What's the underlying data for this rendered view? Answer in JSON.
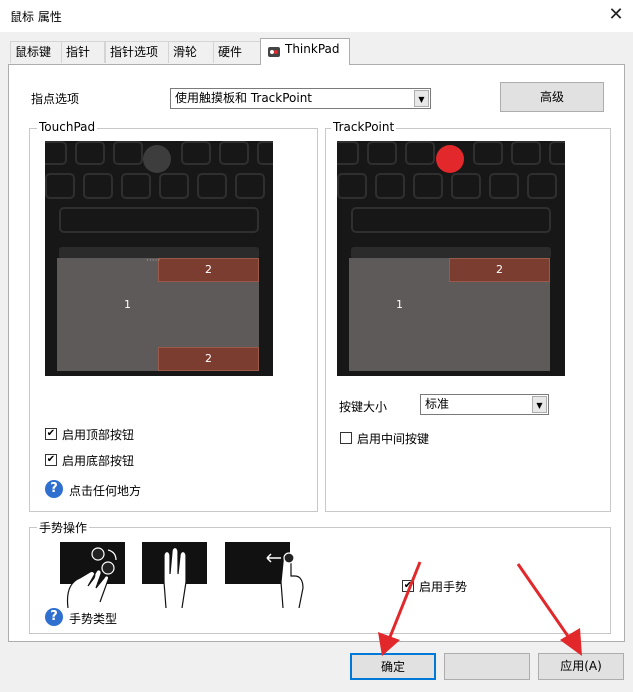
{
  "window": {
    "title": "鼠标 属性",
    "close_label": "✕"
  },
  "tabs": [
    "鼠标键",
    "指针",
    "指针选项",
    "滑轮",
    "硬件",
    "ThinkPad"
  ],
  "pointing": {
    "label": "指点选项",
    "value": "使用触摸板和 TrackPoint",
    "advanced": "高级"
  },
  "touchpad": {
    "title": "TouchPad",
    "zone_main": "1",
    "zone_top": "2",
    "zone_bottom": "2",
    "dots": "·····",
    "options": [
      {
        "label": "启用顶部按钮",
        "checked": true
      },
      {
        "label": "启用底部按钮",
        "checked": true
      }
    ],
    "help": "点击任何地方"
  },
  "trackpoint": {
    "title": "TrackPoint",
    "zone_main": "1",
    "zone_top": "2",
    "size_label": "按键大小",
    "size_value": "标准",
    "middle_label": "启用中间按键",
    "middle_checked": false
  },
  "gestures": {
    "title": "手势操作",
    "enable_label": "启用手势",
    "enable_checked": true,
    "help": "手势类型"
  },
  "footer": {
    "ok": "确定",
    "cancel": "",
    "apply": "应用(A)"
  },
  "colors": {
    "accent": "#e2282b",
    "zone": "#7c3d31",
    "help": "#2f6fcf"
  }
}
